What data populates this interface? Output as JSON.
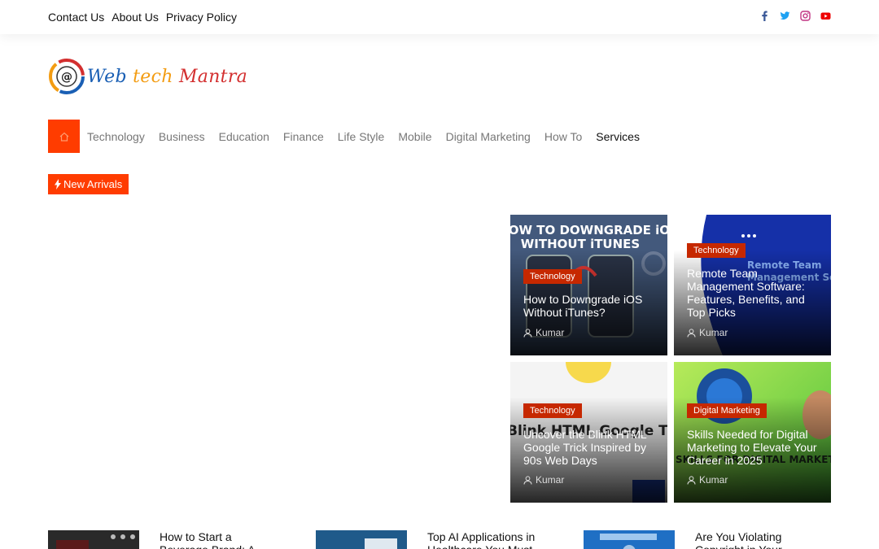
{
  "topbar": {
    "links": [
      "Contact Us",
      "About Us",
      "Privacy Policy"
    ],
    "social": [
      "facebook-icon",
      "twitter-icon",
      "instagram-icon",
      "youtube-icon"
    ]
  },
  "logo": {
    "part1": "Web ",
    "part2": "tech ",
    "part3": "Mantra"
  },
  "nav": {
    "home_icon": "home-icon",
    "items": [
      "Technology",
      "Business",
      "Education",
      "Finance",
      "Life Style",
      "Mobile",
      "Digital Marketing",
      "How To",
      "Services"
    ]
  },
  "new_arrivals": {
    "label": "New Arrivals",
    "icon": "bolt-icon"
  },
  "cards": [
    {
      "category": "Technology",
      "title": "How to Downgrade iOS Without iTunes?",
      "author": "Kumar",
      "image_text": "HOW TO DOWNGRADE iOS WITHOUT iTUNES"
    },
    {
      "category": "Technology",
      "title": "Remote Team Management Software: Features, Benefits, and Top Picks",
      "author": "Kumar",
      "image_text": "Remote Team Management So"
    },
    {
      "category": "Technology",
      "title": "Uncover the Blink HTML Google Trick Inspired by 90s Web Days",
      "author": "Kumar",
      "image_text": "Blink HTML Google Tric"
    },
    {
      "category": "Digital Marketing",
      "title": "Skills Needed for Digital Marketing to Elevate Your Career in 2025",
      "author": "Kumar",
      "image_text": "SKILLS FOR DIGITAL MARKETING"
    }
  ],
  "bottom_posts": [
    {
      "title": "How to Start a Beverage Brand: A Step-by-Step"
    },
    {
      "title": "Top AI Applications in Healthcare You Must Know"
    },
    {
      "title": "Are You Violating Copyright in Your Branding?"
    }
  ],
  "colors": {
    "accent": "#ff3c00",
    "category": "#c62800"
  }
}
